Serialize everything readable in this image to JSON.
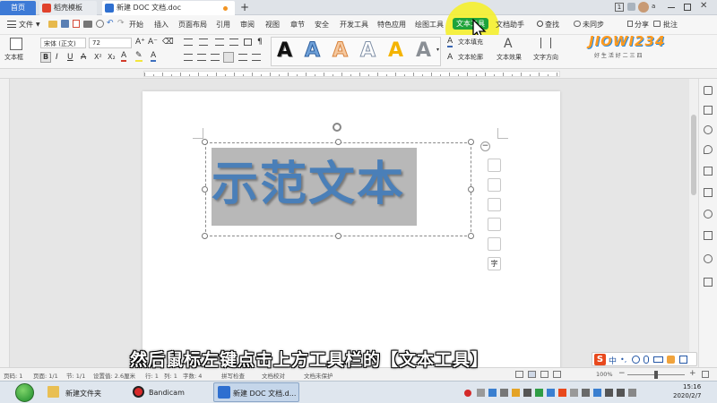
{
  "tabs": {
    "home": "首页",
    "template": "稻壳模板",
    "doc": "新建 DOC 文档.doc",
    "add": "+"
  },
  "title_right": {
    "count": "1",
    "user": "a"
  },
  "menu": {
    "file": "文件",
    "items": [
      "开始",
      "插入",
      "页面布局",
      "引用",
      "审阅",
      "视图",
      "章节",
      "安全",
      "开发工具",
      "特色应用",
      "绘图工具",
      "文本工具",
      "文档助手"
    ],
    "search": "查找",
    "sync": "未同步",
    "share": "分享",
    "comment": "批注"
  },
  "ribbon": {
    "textbox": "文本框",
    "font_name": "宋体 (正文)",
    "font_size": "72",
    "art_letter": "A",
    "text_fill": "文本填充",
    "text_outline": "文本轮廓",
    "text_effect": "文本效果",
    "text_direction": "文字方向"
  },
  "document": {
    "sample_text": "示范文本"
  },
  "side_tools": {
    "collapse": "−",
    "char": "字"
  },
  "status": {
    "page": "页码: 1",
    "pages": "页面: 1/1",
    "section": "节: 1/1",
    "setting": "设置值: 2.6厘米",
    "row": "行: 1",
    "col": "列: 1",
    "chars": "字数: 4",
    "spell": "拼写检查",
    "proof": "文档校对",
    "protect": "文档未保护",
    "zoom": "100%"
  },
  "caption": "然后鼠标左键点击上方工具栏的【文本工具】",
  "taskbar": {
    "explorer": "新建文件夹",
    "bandicam": "Bandicam",
    "wps": "新建 DOC 文档.d...",
    "time": "15:16",
    "date": "2020/2/7"
  },
  "watermark": {
    "brand": "JIOWI234",
    "slogan": "好 生 活 好 二 三 四"
  },
  "ime": {
    "logo": "S",
    "lang": "中"
  },
  "colors": {
    "accent_green": "#1fa33b",
    "text_blue": "#4a7fb8",
    "selection_gray": "#b8b8b8",
    "highlight_yellow": "#f5ef2e"
  }
}
